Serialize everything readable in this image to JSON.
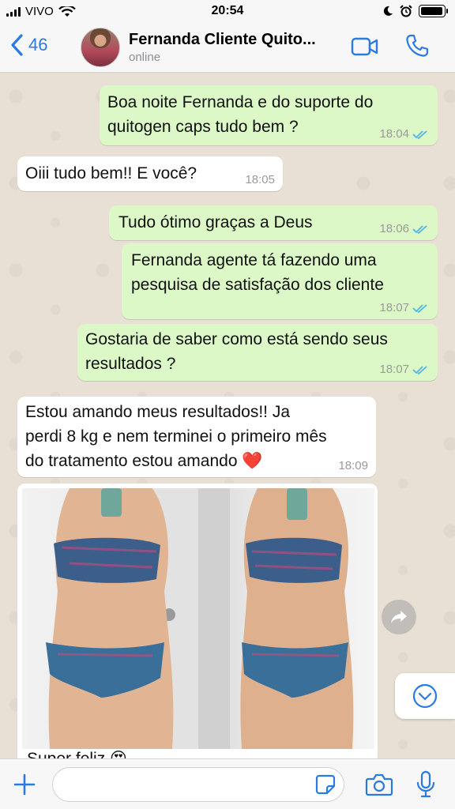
{
  "status_bar": {
    "carrier": "VIVO",
    "time": "20:54",
    "battery_level": 0.95
  },
  "header": {
    "back_count": "46",
    "contact_name": "Fernanda Cliente Quito...",
    "contact_status": "online"
  },
  "messages": [
    {
      "direction": "out",
      "lines": [
        "Boa noite Fernanda e do suporte do",
        "quitogen caps tudo bem ?"
      ],
      "time": "18:04",
      "read": true
    },
    {
      "direction": "in",
      "lines": [
        "Oiii tudo bem!! E você?"
      ],
      "time": "18:05"
    },
    {
      "direction": "out",
      "lines": [
        "Tudo ótimo graças a Deus"
      ],
      "time": "18:06",
      "read": true
    },
    {
      "direction": "out",
      "lines": [
        "Fernanda agente tá fazendo uma",
        "pesquisa de satisfação dos cliente"
      ],
      "time": "18:07",
      "read": true
    },
    {
      "direction": "out",
      "lines": [
        "Gostaria de saber como está sendo seus",
        "resultados ?"
      ],
      "time": "18:07",
      "read": true
    },
    {
      "direction": "in",
      "lines": [
        "Estou amando meus resultados!! Ja",
        "perdi 8 kg e nem terminei o primeiro mês",
        "do tratamento estou amando ❤️"
      ],
      "time": "18:09"
    }
  ],
  "media": {
    "caption": "Super feliz 😍"
  },
  "input": {
    "placeholder": ""
  },
  "colors": {
    "accent": "#2a7ae2",
    "outgoing_bubble": "#dcf8c6",
    "incoming_bubble": "#ffffff",
    "read_ticks": "#4fb6ec",
    "chat_background": "#e9e0d5"
  }
}
